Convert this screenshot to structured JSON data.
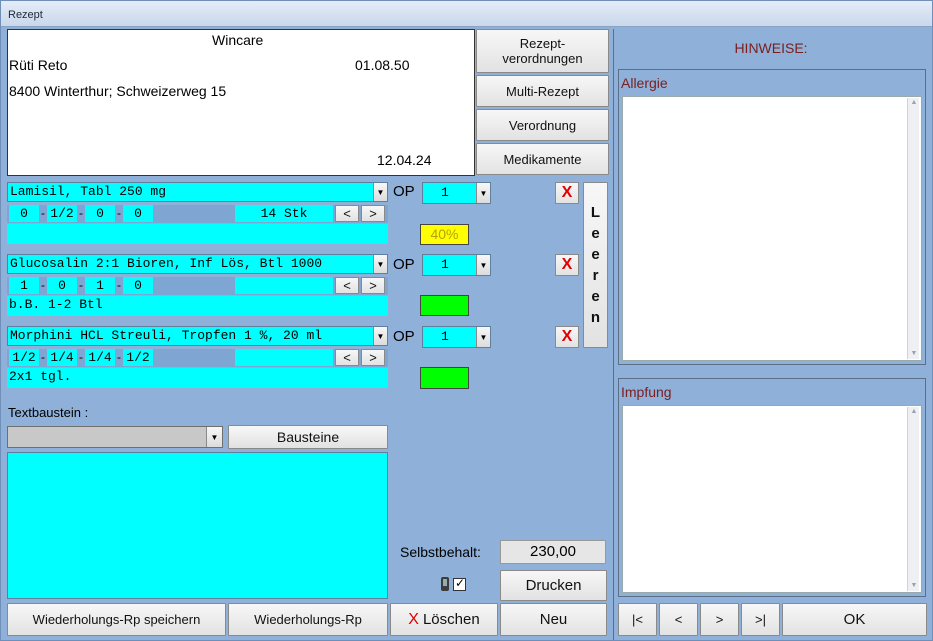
{
  "window": {
    "title": "Rezept"
  },
  "patient": {
    "practice": "Wincare",
    "name": "Rüti Reto",
    "birthdate": "01.08.50",
    "address": "8400 Winterthur; Schweizerweg 15",
    "date": "12.04.24"
  },
  "side_buttons": {
    "rezept_verordnungen_line1": "Rezept-",
    "rezept_verordnungen_line2": "verordnungen",
    "multi_rezept": "Multi-Rezept",
    "verordnung": "Verordnung",
    "medikamente": "Medikamente"
  },
  "medications": [
    {
      "name": "Lamisil,  Tabl 250 mg",
      "unit": "OP",
      "qty": "1",
      "dose": [
        "0",
        "1/2",
        "0",
        "0"
      ],
      "stock": "14 Stk",
      "note": "",
      "badge": "40%",
      "badge_color": "#ffff00",
      "delete": "X"
    },
    {
      "name": "Glucosalin 2:1 Bioren, Inf Lös, Btl 1000",
      "unit": "OP",
      "qty": "1",
      "dose": [
        "1",
        "0",
        "1",
        "0"
      ],
      "stock": "",
      "note": "b.B. 1-2 Btl",
      "badge": "",
      "badge_color": "#00ff00",
      "delete": "X"
    },
    {
      "name": "Morphini HCL Streuli, Tropfen 1 %, 20 ml",
      "unit": "OP",
      "qty": "1",
      "dose": [
        "1/2",
        "1/4",
        "1/4",
        "1/2"
      ],
      "stock": "",
      "note": "2x1 tgl.",
      "badge": "",
      "badge_color": "#00ff00",
      "delete": "X"
    }
  ],
  "dose_separator": "-",
  "stepper": {
    "prev": "<",
    "next": ">"
  },
  "leeren": [
    "L",
    "e",
    "e",
    "r",
    "e",
    "n"
  ],
  "textbaustein": {
    "label": "Textbaustein :",
    "selected": "",
    "button": "Bausteine",
    "text": ""
  },
  "selbstbehalt": {
    "label": "Selbstbehalt:",
    "value": "230,00"
  },
  "buttons": {
    "drucken": "Drucken",
    "wiederholung_speichern": "Wiederholungs-Rp speichern",
    "wiederholung": "Wiederholungs-Rp",
    "loeschen_x": "X",
    "loeschen": "Löschen",
    "neu": "Neu",
    "ok": "OK"
  },
  "hinweise": {
    "title": "HINWEISE:",
    "allergie_label": "Allergie",
    "allergie_text": "",
    "impfung_label": "Impfung",
    "impfung_text": ""
  },
  "nav": {
    "first": "|<",
    "prev": "<",
    "next": ">",
    "last": ">|"
  },
  "colors": {
    "field": "#00ffff",
    "window": "#8fb0d9",
    "accent": "#7a1f1f"
  }
}
